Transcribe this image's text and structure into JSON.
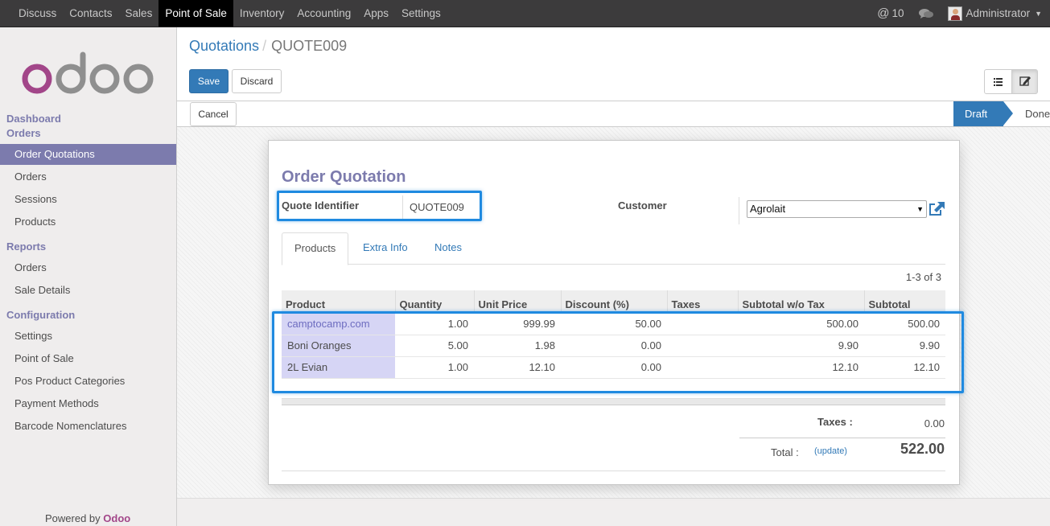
{
  "topbar": {
    "menu": [
      "Discuss",
      "Contacts",
      "Sales",
      "Point of Sale",
      "Inventory",
      "Accounting",
      "Apps",
      "Settings"
    ],
    "active_index": 3,
    "messages_count": "10",
    "user": "Administrator"
  },
  "sidebar": {
    "logo_text": "odoo",
    "sections": {
      "dashboard": "Dashboard",
      "orders": "Orders",
      "reports": "Reports",
      "configuration": "Configuration"
    },
    "orders_items": [
      "Order Quotations",
      "Orders",
      "Sessions",
      "Products"
    ],
    "reports_items": [
      "Orders",
      "Sale Details"
    ],
    "config_items": [
      "Settings",
      "Point of Sale",
      "Pos Product Categories",
      "Payment Methods",
      "Barcode Nomenclatures"
    ],
    "active_item": "Order Quotations",
    "powered_by": "Powered by",
    "powered_brand": "Odoo"
  },
  "control_panel": {
    "breadcrumb_parent": "Quotations",
    "breadcrumb_current": "QUOTE009",
    "save_label": "Save",
    "discard_label": "Discard"
  },
  "statusbar": {
    "cancel_label": "Cancel",
    "stages": [
      "Draft",
      "Done"
    ],
    "active_stage": "Draft"
  },
  "form": {
    "title": "Order Quotation",
    "quote_identifier_label": "Quote Identifier",
    "quote_identifier_value": "QUOTE009",
    "customer_label": "Customer",
    "customer_value": "Agrolait",
    "tabs": [
      "Products",
      "Extra Info",
      "Notes"
    ],
    "active_tab": "Products",
    "pager": "1-3 of 3",
    "columns": [
      "Product",
      "Quantity",
      "Unit Price",
      "Discount (%)",
      "Taxes",
      "Subtotal w/o Tax",
      "Subtotal"
    ],
    "rows": [
      [
        "camptocamp.com",
        "1.00",
        "999.99",
        "50.00",
        "",
        "500.00",
        "500.00"
      ],
      [
        "Boni Oranges",
        "5.00",
        "1.98",
        "0.00",
        "",
        "9.90",
        "9.90"
      ],
      [
        "2L Evian",
        "1.00",
        "12.10",
        "0.00",
        "",
        "12.10",
        "12.10"
      ]
    ],
    "taxes_label": "Taxes :",
    "taxes_value": "0.00",
    "total_label": "Total :",
    "update_label": "(update)",
    "total_value": "522.00"
  },
  "colors": {
    "accent": "#7c7bad",
    "primary_button": "#337ab7",
    "highlight_box": "#1f8ae0",
    "topbar": "#3c3b3c"
  }
}
